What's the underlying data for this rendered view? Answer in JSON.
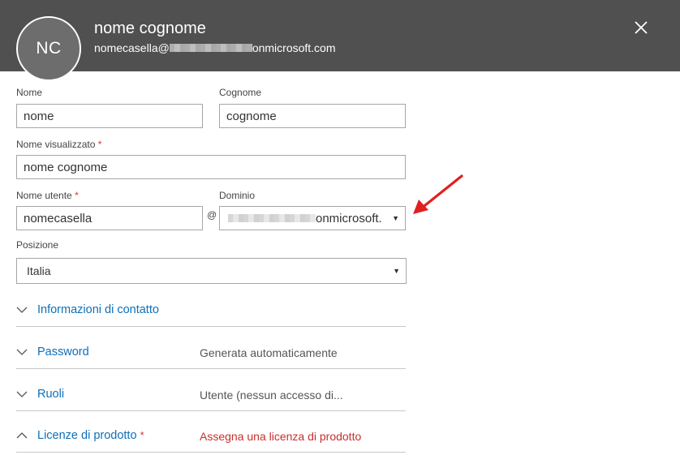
{
  "header": {
    "initials": "NC",
    "name": "nome cognome",
    "email_prefix": "nomecasella@",
    "email_suffix": "onmicrosoft.com"
  },
  "form": {
    "first_name": {
      "label": "Nome",
      "value": "nome"
    },
    "last_name": {
      "label": "Cognome",
      "value": "cognome"
    },
    "display_name": {
      "label": "Nome visualizzato",
      "required_mark": "*",
      "value": "nome cognome"
    },
    "username": {
      "label": "Nome utente",
      "required_mark": "*",
      "value": "nomecasella"
    },
    "at_sign": "@",
    "domain": {
      "label": "Dominio",
      "value_suffix": "onmicrosoft."
    },
    "location": {
      "label": "Posizione",
      "value": "Italia"
    }
  },
  "sections": {
    "contact": {
      "title": "Informazioni di contatto"
    },
    "password": {
      "title": "Password",
      "value": "Generata automaticamente"
    },
    "roles": {
      "title": "Ruoli",
      "value": "Utente (nessun accesso di..."
    },
    "licenses": {
      "title": "Licenze di prodotto",
      "required_mark": "*",
      "value": "Assegna una licenza di prodotto"
    }
  },
  "colors": {
    "header_bg": "#505050",
    "link": "#0f6fb8",
    "required": "#d13438",
    "annotation_arrow": "#e02020"
  },
  "icons": [
    "close-icon",
    "chevron-down-icon",
    "chevron-up-icon",
    "caret-down-icon",
    "annotation-arrow"
  ]
}
